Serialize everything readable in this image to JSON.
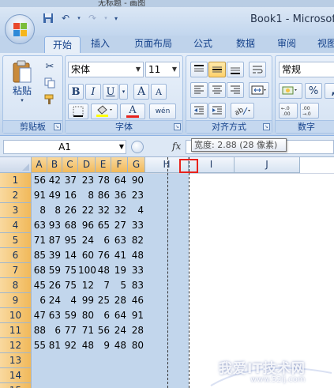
{
  "top_strip": {
    "text": "无标题 - 画图"
  },
  "title_bar": {
    "title": "Book1 - Microsof"
  },
  "quick_access": {
    "save_icon": "save-icon",
    "undo_icon": "undo-icon",
    "redo_icon": "redo-icon"
  },
  "tabs": [
    {
      "label": "开始",
      "active": true
    },
    {
      "label": "插入",
      "active": false
    },
    {
      "label": "页面布局",
      "active": false
    },
    {
      "label": "公式",
      "active": false
    },
    {
      "label": "数据",
      "active": false
    },
    {
      "label": "审阅",
      "active": false
    },
    {
      "label": "视图",
      "active": false
    }
  ],
  "ribbon": {
    "clipboard": {
      "label": "剪贴板",
      "paste_label": "粘贴"
    },
    "font": {
      "label": "字体",
      "font_name": "宋体",
      "font_size": "11",
      "bold": "B",
      "italic": "I",
      "underline": "U",
      "grow": "A",
      "shrink": "A",
      "font_color_letter": "A",
      "phonetic": "wén"
    },
    "alignment": {
      "label": "对齐方式"
    },
    "number": {
      "label": "数字",
      "format": "常规",
      "percent": "%"
    }
  },
  "formula_bar": {
    "name_box": "A1",
    "fx": "fx",
    "value": ""
  },
  "tooltip": {
    "text": "宽度: 2.88 (28 像素)"
  },
  "sheet": {
    "columns": [
      "A",
      "B",
      "C",
      "D",
      "E",
      "F",
      "G",
      "H",
      "I",
      "J"
    ],
    "rows": [
      "1",
      "2",
      "3",
      "4",
      "5",
      "6",
      "7",
      "8",
      "9",
      "10",
      "11",
      "12",
      "13",
      "14",
      "15"
    ],
    "data": [
      [
        "56",
        "42",
        "37",
        "23",
        "78",
        "64",
        "90"
      ],
      [
        "91",
        "49",
        "16",
        "8",
        "86",
        "36",
        "23"
      ],
      [
        "8",
        "8",
        "26",
        "22",
        "32",
        "32",
        "4"
      ],
      [
        "63",
        "93",
        "68",
        "96",
        "65",
        "27",
        "33"
      ],
      [
        "71",
        "87",
        "95",
        "24",
        "6",
        "63",
        "82"
      ],
      [
        "85",
        "39",
        "14",
        "60",
        "76",
        "41",
        "48"
      ],
      [
        "68",
        "59",
        "75",
        "100",
        "48",
        "19",
        "33"
      ],
      [
        "45",
        "26",
        "75",
        "12",
        "7",
        "5",
        "83"
      ],
      [
        "6",
        "24",
        "4",
        "99",
        "25",
        "28",
        "46"
      ],
      [
        "47",
        "63",
        "59",
        "80",
        "6",
        "64",
        "91"
      ],
      [
        "88",
        "6",
        "77",
        "71",
        "56",
        "24",
        "28"
      ],
      [
        "55",
        "81",
        "92",
        "48",
        "9",
        "48",
        "80"
      ]
    ]
  },
  "watermark": {
    "text": "我爱IT技术网",
    "url": "www.52ij.com"
  }
}
